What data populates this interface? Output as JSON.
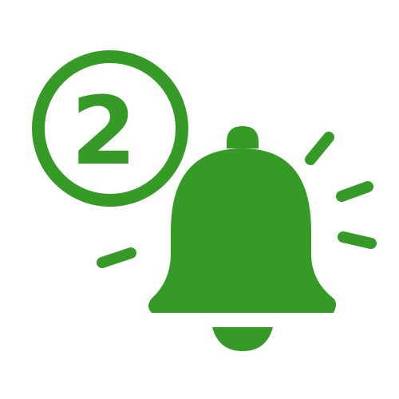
{
  "notification_badge": {
    "count": "2"
  },
  "icon": {
    "name": "bell-notification-icon",
    "color": "#359a26"
  }
}
